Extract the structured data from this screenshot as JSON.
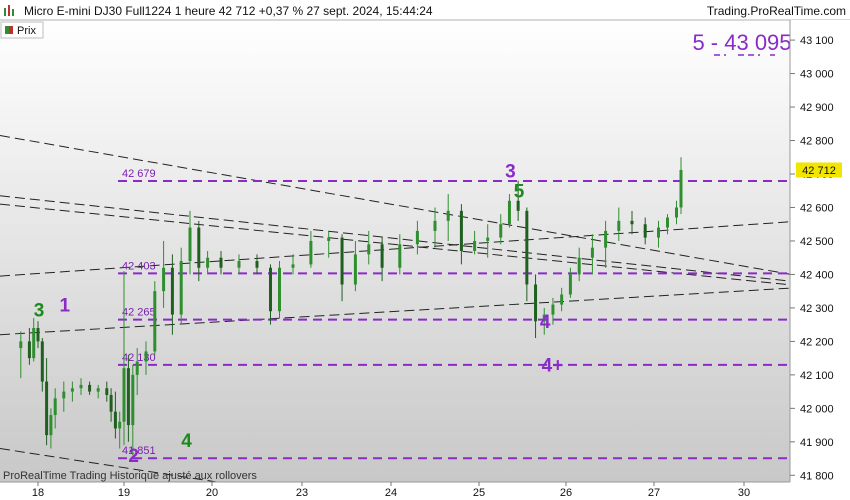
{
  "header": {
    "title": "Micro E-mini DJ30 Full1224 1 heure 42 712 +0,37 % 27 sept. 2024, 15:44:24",
    "brand": "Trading.ProRealTime.com",
    "legend_label": "Prix",
    "footer": "ProRealTime Trading  Historique ajusté aux rollovers"
  },
  "target_label": "5 - 43 095",
  "colors": {
    "candle_up": "#2f8f2f",
    "candle_down": "#1f5f1f",
    "level_line": "#8a2bc8",
    "trend_line": "#222222",
    "price_tag_bg": "#f2e600",
    "wave_purple": "#8a2bc8",
    "wave_green": "#1e8a1e",
    "background_top": "#ffffff",
    "background_bottom": "#c8c8c8"
  },
  "chart_data": {
    "type": "candlestick",
    "instrument": "Micro E-mini DJ30 Full1224",
    "timeframe": "1 heure",
    "last_price": 42712,
    "last_price_label": "42 712",
    "change": "+0,37 %",
    "timestamp": "27 sept. 2024, 15:44:24",
    "ylim": [
      41780,
      43160
    ],
    "y_ticks": [
      {
        "v": 43100,
        "label": "43 100"
      },
      {
        "v": 43000,
        "label": "43 000"
      },
      {
        "v": 42900,
        "label": "42 900"
      },
      {
        "v": 42800,
        "label": "42 800"
      },
      {
        "v": 42700,
        "label": "42 700"
      },
      {
        "v": 42600,
        "label": "42 600"
      },
      {
        "v": 42500,
        "label": "42 500"
      },
      {
        "v": 42400,
        "label": "42 400"
      },
      {
        "v": 42300,
        "label": "42 300"
      },
      {
        "v": 42200,
        "label": "42 200"
      },
      {
        "v": 42100,
        "label": "42 100"
      },
      {
        "v": 42000,
        "label": "42 000"
      },
      {
        "v": 41900,
        "label": "41 900"
      },
      {
        "v": 41800,
        "label": "41 800"
      }
    ],
    "x_ticks": [
      "18",
      "19",
      "20",
      "23",
      "24",
      "25",
      "26",
      "27",
      "30"
    ],
    "levels": [
      {
        "v": 42679,
        "label": "42 679"
      },
      {
        "v": 42403,
        "label": "42 403"
      },
      {
        "v": 42265,
        "label": "42 265"
      },
      {
        "v": 42130,
        "label": "42 130"
      },
      {
        "v": 41851,
        "label": "41 851"
      }
    ],
    "trend_lines": [
      {
        "from": [
          0,
          42815
        ],
        "to": [
          9.2,
          42368
        ]
      },
      {
        "from": [
          0,
          42635
        ],
        "to": [
          9.2,
          42360
        ]
      },
      {
        "from": [
          0,
          42610
        ],
        "to": [
          9.2,
          42350
        ]
      },
      {
        "from": [
          0,
          42220
        ],
        "to": [
          9.2,
          42370
        ]
      },
      {
        "from": [
          0,
          42395
        ],
        "to": [
          9.2,
          42570
        ]
      },
      {
        "from": [
          0,
          41880
        ],
        "to": [
          2.9,
          41745
        ]
      }
    ],
    "wave_labels": [
      {
        "text": "3",
        "x": -0.05,
        "y": 42275,
        "color": "green"
      },
      {
        "text": "1",
        "x": 0.25,
        "y": 42290,
        "color": "purple"
      },
      {
        "text": "2",
        "x": 1.05,
        "y": 41840,
        "color": "purple"
      },
      {
        "text": "4",
        "x": 1.65,
        "y": 41885,
        "color": "green"
      },
      {
        "text": "3",
        "x": 5.3,
        "y": 42690,
        "color": "purple"
      },
      {
        "text": "5",
        "x": 5.4,
        "y": 42630,
        "color": "green"
      },
      {
        "text": "4",
        "x": 5.7,
        "y": 42240,
        "color": "purple"
      },
      {
        "text": "4+",
        "x": 5.72,
        "y": 42110,
        "color": "purple"
      }
    ],
    "candles": [
      {
        "x": -0.2,
        "o": 42180,
        "h": 42230,
        "l": 42090,
        "c": 42200
      },
      {
        "x": -0.1,
        "o": 42200,
        "h": 42240,
        "l": 42130,
        "c": 42150
      },
      {
        "x": -0.05,
        "o": 42150,
        "h": 42270,
        "l": 42140,
        "c": 42240
      },
      {
        "x": 0.0,
        "o": 42240,
        "h": 42260,
        "l": 42180,
        "c": 42200
      },
      {
        "x": 0.05,
        "o": 42200,
        "h": 42210,
        "l": 42050,
        "c": 42080
      },
      {
        "x": 0.1,
        "o": 42080,
        "h": 42150,
        "l": 41890,
        "c": 41920
      },
      {
        "x": 0.15,
        "o": 41920,
        "h": 42000,
        "l": 41880,
        "c": 41980
      },
      {
        "x": 0.2,
        "o": 41980,
        "h": 42060,
        "l": 41940,
        "c": 42030
      },
      {
        "x": 0.3,
        "o": 42030,
        "h": 42080,
        "l": 41990,
        "c": 42050
      },
      {
        "x": 0.4,
        "o": 42050,
        "h": 42080,
        "l": 42020,
        "c": 42060
      },
      {
        "x": 0.5,
        "o": 42060,
        "h": 42090,
        "l": 42040,
        "c": 42070
      },
      {
        "x": 0.6,
        "o": 42070,
        "h": 42080,
        "l": 42040,
        "c": 42050
      },
      {
        "x": 0.7,
        "o": 42050,
        "h": 42070,
        "l": 42030,
        "c": 42060
      },
      {
        "x": 0.8,
        "o": 42060,
        "h": 42080,
        "l": 42020,
        "c": 42040
      },
      {
        "x": 0.85,
        "o": 42040,
        "h": 42060,
        "l": 41960,
        "c": 41990
      },
      {
        "x": 0.9,
        "o": 41990,
        "h": 42050,
        "l": 41910,
        "c": 41940
      },
      {
        "x": 0.95,
        "o": 41940,
        "h": 41990,
        "l": 41880,
        "c": 41960
      },
      {
        "x": 1.0,
        "o": 41960,
        "h": 42410,
        "l": 41890,
        "c": 42120
      },
      {
        "x": 1.05,
        "o": 42120,
        "h": 42160,
        "l": 41900,
        "c": 41950
      },
      {
        "x": 1.1,
        "o": 41950,
        "h": 42130,
        "l": 41860,
        "c": 42100
      },
      {
        "x": 1.15,
        "o": 42100,
        "h": 42180,
        "l": 42040,
        "c": 42140
      },
      {
        "x": 1.25,
        "o": 42140,
        "h": 42200,
        "l": 42100,
        "c": 42170
      },
      {
        "x": 1.35,
        "o": 42170,
        "h": 42380,
        "l": 42160,
        "c": 42350
      },
      {
        "x": 1.45,
        "o": 42350,
        "h": 42500,
        "l": 42300,
        "c": 42420
      },
      {
        "x": 1.55,
        "o": 42420,
        "h": 42460,
        "l": 42220,
        "c": 42280
      },
      {
        "x": 1.65,
        "o": 42280,
        "h": 42480,
        "l": 42250,
        "c": 42440
      },
      {
        "x": 1.75,
        "o": 42440,
        "h": 42590,
        "l": 42400,
        "c": 42540
      },
      {
        "x": 1.85,
        "o": 42540,
        "h": 42560,
        "l": 42380,
        "c": 42420
      },
      {
        "x": 1.95,
        "o": 42420,
        "h": 42470,
        "l": 42400,
        "c": 42450
      },
      {
        "x": 2.1,
        "o": 42450,
        "h": 42470,
        "l": 42400,
        "c": 42420
      },
      {
        "x": 2.3,
        "o": 42420,
        "h": 42460,
        "l": 42400,
        "c": 42440
      },
      {
        "x": 2.5,
        "o": 42440,
        "h": 42460,
        "l": 42400,
        "c": 42420
      },
      {
        "x": 2.65,
        "o": 42420,
        "h": 42430,
        "l": 42250,
        "c": 42290
      },
      {
        "x": 2.75,
        "o": 42290,
        "h": 42440,
        "l": 42270,
        "c": 42420
      },
      {
        "x": 2.9,
        "o": 42420,
        "h": 42460,
        "l": 42400,
        "c": 42430
      },
      {
        "x": 3.1,
        "o": 42430,
        "h": 42530,
        "l": 42420,
        "c": 42500
      },
      {
        "x": 3.3,
        "o": 42500,
        "h": 42530,
        "l": 42450,
        "c": 42510
      },
      {
        "x": 3.45,
        "o": 42510,
        "h": 42520,
        "l": 42320,
        "c": 42370
      },
      {
        "x": 3.6,
        "o": 42370,
        "h": 42500,
        "l": 42350,
        "c": 42460
      },
      {
        "x": 3.75,
        "o": 42460,
        "h": 42530,
        "l": 42430,
        "c": 42490
      },
      {
        "x": 3.9,
        "o": 42490,
        "h": 42510,
        "l": 42380,
        "c": 42420
      },
      {
        "x": 4.1,
        "o": 42420,
        "h": 42520,
        "l": 42400,
        "c": 42490
      },
      {
        "x": 4.3,
        "o": 42490,
        "h": 42560,
        "l": 42460,
        "c": 42530
      },
      {
        "x": 4.5,
        "o": 42530,
        "h": 42600,
        "l": 42480,
        "c": 42560
      },
      {
        "x": 4.65,
        "o": 42560,
        "h": 42640,
        "l": 42500,
        "c": 42590
      },
      {
        "x": 4.8,
        "o": 42590,
        "h": 42610,
        "l": 42430,
        "c": 42470
      },
      {
        "x": 4.95,
        "o": 42470,
        "h": 42530,
        "l": 42460,
        "c": 42500
      },
      {
        "x": 5.1,
        "o": 42500,
        "h": 42550,
        "l": 42450,
        "c": 42510
      },
      {
        "x": 5.25,
        "o": 42510,
        "h": 42580,
        "l": 42490,
        "c": 42550
      },
      {
        "x": 5.35,
        "o": 42550,
        "h": 42640,
        "l": 42540,
        "c": 42620
      },
      {
        "x": 5.45,
        "o": 42620,
        "h": 42680,
        "l": 42560,
        "c": 42590
      },
      {
        "x": 5.55,
        "o": 42590,
        "h": 42600,
        "l": 42320,
        "c": 42370
      },
      {
        "x": 5.65,
        "o": 42370,
        "h": 42400,
        "l": 42210,
        "c": 42260
      },
      {
        "x": 5.75,
        "o": 42260,
        "h": 42300,
        "l": 42220,
        "c": 42280
      },
      {
        "x": 5.85,
        "o": 42280,
        "h": 42330,
        "l": 42250,
        "c": 42310
      },
      {
        "x": 5.95,
        "o": 42310,
        "h": 42360,
        "l": 42290,
        "c": 42340
      },
      {
        "x": 6.05,
        "o": 42340,
        "h": 42420,
        "l": 42330,
        "c": 42400
      },
      {
        "x": 6.15,
        "o": 42400,
        "h": 42480,
        "l": 42380,
        "c": 42450
      },
      {
        "x": 6.3,
        "o": 42450,
        "h": 42520,
        "l": 42400,
        "c": 42480
      },
      {
        "x": 6.45,
        "o": 42480,
        "h": 42560,
        "l": 42420,
        "c": 42530
      },
      {
        "x": 6.6,
        "o": 42530,
        "h": 42600,
        "l": 42500,
        "c": 42560
      },
      {
        "x": 6.75,
        "o": 42560,
        "h": 42590,
        "l": 42520,
        "c": 42550
      },
      {
        "x": 6.9,
        "o": 42550,
        "h": 42570,
        "l": 42490,
        "c": 42510
      },
      {
        "x": 7.05,
        "o": 42510,
        "h": 42560,
        "l": 42480,
        "c": 42540
      },
      {
        "x": 7.15,
        "o": 42540,
        "h": 42580,
        "l": 42520,
        "c": 42570
      },
      {
        "x": 7.25,
        "o": 42570,
        "h": 42620,
        "l": 42550,
        "c": 42600
      },
      {
        "x": 7.3,
        "o": 42600,
        "h": 42750,
        "l": 42580,
        "c": 42712
      }
    ]
  }
}
